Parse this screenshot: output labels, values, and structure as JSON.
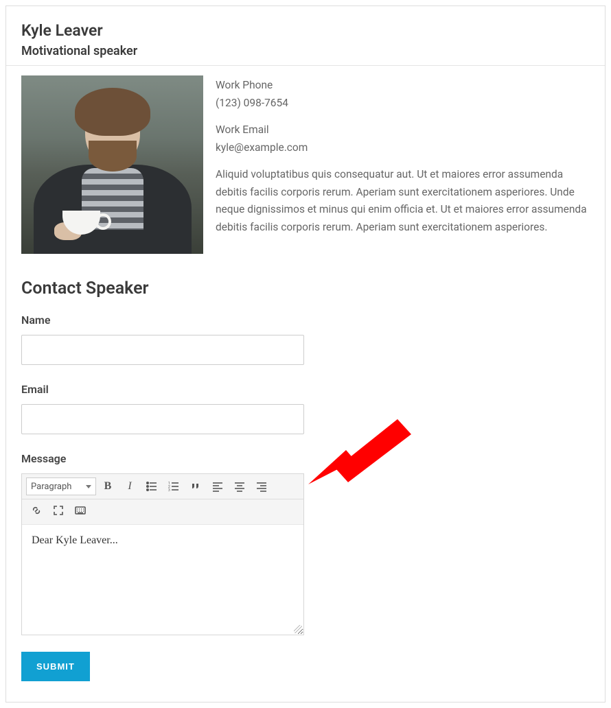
{
  "profile": {
    "name": "Kyle Leaver",
    "title": "Motivational speaker",
    "phone_label": "Work Phone",
    "phone_value": "(123) 098-7654",
    "email_label": "Work Email",
    "email_value": "kyle@example.com",
    "bio": "Aliquid voluptatibus quis consequatur aut. Ut et maiores error assumenda debitis facilis corporis rerum. Aperiam sunt exercitationem asperiores. Unde neque dignissimos et minus qui enim officia et. Ut et maiores error assumenda debitis facilis corporis rerum. Aperiam sunt exercitationem asperiores."
  },
  "form": {
    "heading": "Contact Speaker",
    "name_label": "Name",
    "name_value": "",
    "email_label": "Email",
    "email_value": "",
    "message_label": "Message",
    "editor": {
      "format_selected": "Paragraph",
      "body_text": "Dear Kyle Leaver..."
    },
    "submit_label": "Submit"
  },
  "annotation": {
    "arrow_color": "#ff0000"
  }
}
